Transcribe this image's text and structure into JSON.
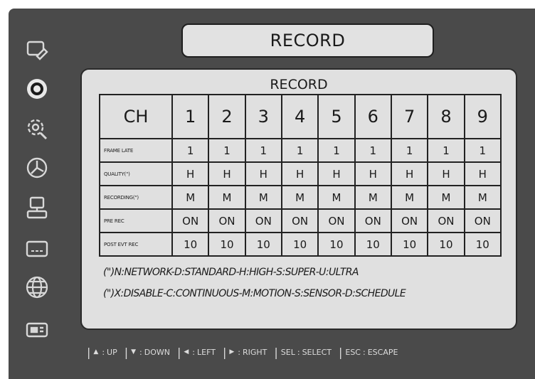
{
  "header": {
    "title": "RECORD"
  },
  "sidebar": {
    "items": [
      {
        "icon": "monitor-edit-icon"
      },
      {
        "icon": "record-icon"
      },
      {
        "icon": "settings-icon"
      },
      {
        "icon": "clock-icon"
      },
      {
        "icon": "computer-icon"
      },
      {
        "icon": "display-icon"
      },
      {
        "icon": "globe-icon"
      },
      {
        "icon": "device-icon"
      }
    ]
  },
  "panel": {
    "title": "RECORD",
    "table": {
      "ch_label": "CH",
      "channels": [
        "1",
        "2",
        "3",
        "4",
        "5",
        "6",
        "7",
        "8",
        "9"
      ],
      "rows": [
        {
          "label": "FRAME LATE",
          "values": [
            "1",
            "1",
            "1",
            "1",
            "1",
            "1",
            "1",
            "1",
            "1"
          ]
        },
        {
          "label": "QUALITY(\")",
          "values": [
            "H",
            "H",
            "H",
            "H",
            "H",
            "H",
            "H",
            "H",
            "H"
          ]
        },
        {
          "label": "RECORDING(\")",
          "values": [
            "M",
            "M",
            "M",
            "M",
            "M",
            "M",
            "M",
            "M",
            "M"
          ]
        },
        {
          "label": "PRE REC",
          "values": [
            "ON",
            "ON",
            "ON",
            "ON",
            "ON",
            "ON",
            "ON",
            "ON",
            "ON"
          ]
        },
        {
          "label": "POST EVT REC",
          "values": [
            "10",
            "10",
            "10",
            "10",
            "10",
            "10",
            "10",
            "10",
            "10"
          ]
        }
      ]
    },
    "legend": [
      "(\")N:NETWORK-D:STANDARD-H:HIGH-S:SUPER-U:ULTRA",
      "(\")X:DISABLE-C:CONTINUOUS-M:MOTION-S:SENSOR-D:SCHEDULE"
    ]
  },
  "footer": {
    "keys": [
      {
        "key": "▲",
        "action": "UP"
      },
      {
        "key": "▼",
        "action": "DOWN"
      },
      {
        "key": "◀",
        "action": "LEFT"
      },
      {
        "key": "▶",
        "action": "RIGHT"
      },
      {
        "key": "SEL",
        "action": "SELECT"
      },
      {
        "key": "ESC",
        "action": "ESCAPE"
      }
    ]
  }
}
